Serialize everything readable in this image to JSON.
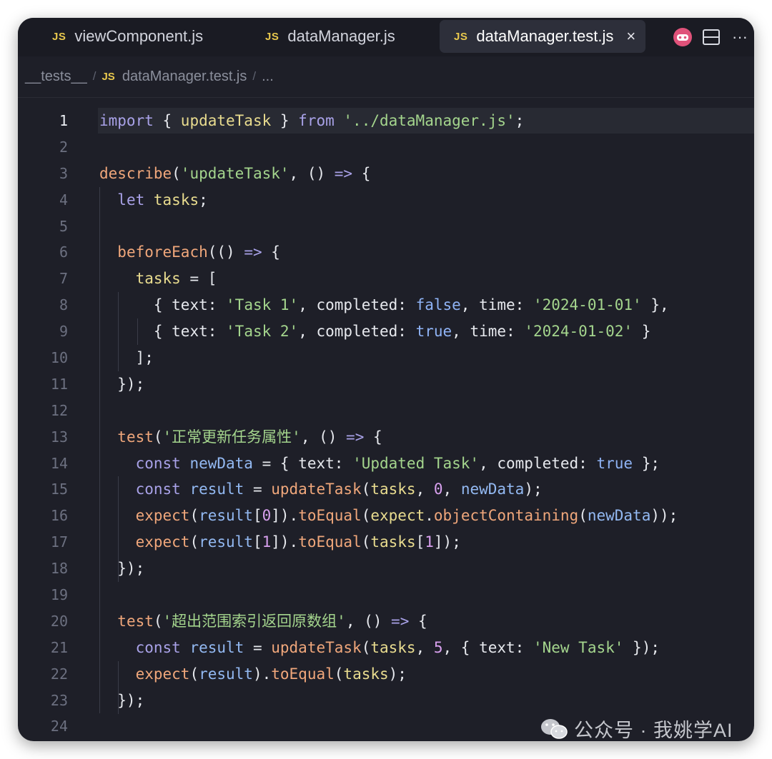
{
  "tabs": [
    {
      "lang": "JS",
      "name": "viewComponent.js"
    },
    {
      "lang": "JS",
      "name": "dataManager.js"
    },
    {
      "lang": "JS",
      "name": "dataManager.test.js",
      "close": "×"
    }
  ],
  "tab_actions": [
    "copilot-icon",
    "split-editor-icon",
    "more-icon"
  ],
  "tab_more": "···",
  "breadcrumb": {
    "folder": "__tests__",
    "lang": "JS",
    "file": "dataManager.test.js",
    "more": "..."
  },
  "active_line": 1,
  "line_numbers": [
    "1",
    "2",
    "3",
    "4",
    "5",
    "6",
    "7",
    "8",
    "9",
    "10",
    "11",
    "12",
    "13",
    "14",
    "15",
    "16",
    "17",
    "18",
    "19",
    "20",
    "21",
    "22",
    "23",
    "24"
  ],
  "code_lines": [
    "import { updateTask } from '../dataManager.js';",
    "",
    "describe('updateTask', () => {",
    "  let tasks;",
    "",
    "  beforeEach(() => {",
    "    tasks = [",
    "      { text: 'Task 1', completed: false, time: '2024-01-01' },",
    "      { text: 'Task 2', completed: true, time: '2024-01-02' }",
    "    ];",
    "  });",
    "",
    "  test('正常更新任务属性', () => {",
    "    const newData = { text: 'Updated Task', completed: true };",
    "    const result = updateTask(tasks, 0, newData);",
    "    expect(result[0]).toEqual(expect.objectContaining(newData));",
    "    expect(result[1]).toEqual(tasks[1]);",
    "  });",
    "",
    "  test('超出范围索引返回原数组', () => {",
    "    const result = updateTask(tasks, 5, { text: 'New Task' });",
    "    expect(result).toEqual(tasks);",
    "  });",
    ""
  ],
  "watermark": "公众号 · 我姚学AI",
  "colors": {
    "background": "#1e1f28",
    "keyword": "#a9a2e8",
    "function": "#f0a77b",
    "string": "#a4d58d",
    "variable": "#e9dc8f",
    "boolean": "#8fb3f5",
    "number": "#d8a0ee",
    "js_badge": "#e8c84d"
  }
}
